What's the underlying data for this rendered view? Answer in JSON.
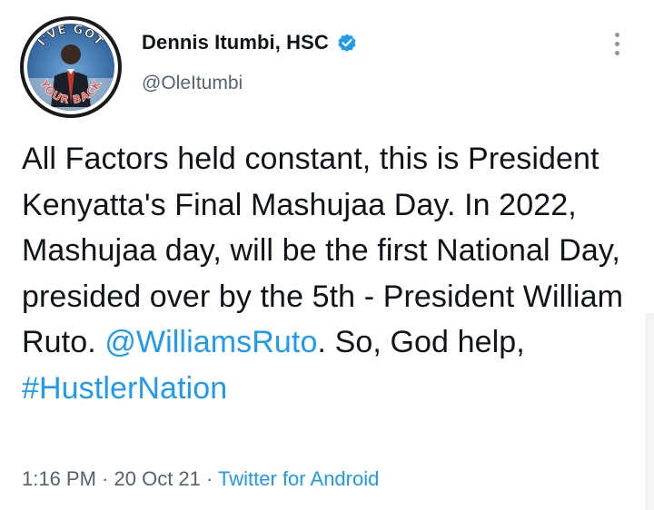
{
  "author": {
    "display_name": "Dennis Itumbi, HSC",
    "handle": "@OleItumbi",
    "verified_icon": "verified-badge-icon",
    "avatar_ring_text_top": "I'VE GOT",
    "avatar_ring_text_bottom": "YOUR BACK"
  },
  "tweet": {
    "text_1": "All Factors held constant, this is President Kenyatta's Final Mashujaa Day. In 2022, Mashujaa day, will be the first National Day, presided over by the 5th - President William Ruto. ",
    "mention": "@WilliamsRuto",
    "text_2": ". So, God help, ",
    "hashtag": "#HustlerNation"
  },
  "meta": {
    "time": "1:16 PM",
    "separator_1": " · ",
    "date": "20 Oct 21",
    "separator_2": " · ",
    "source": "Twitter for Android"
  },
  "colors": {
    "link": "#1d9bf0",
    "secondary_text": "#536471",
    "primary_text": "#0f1419"
  }
}
